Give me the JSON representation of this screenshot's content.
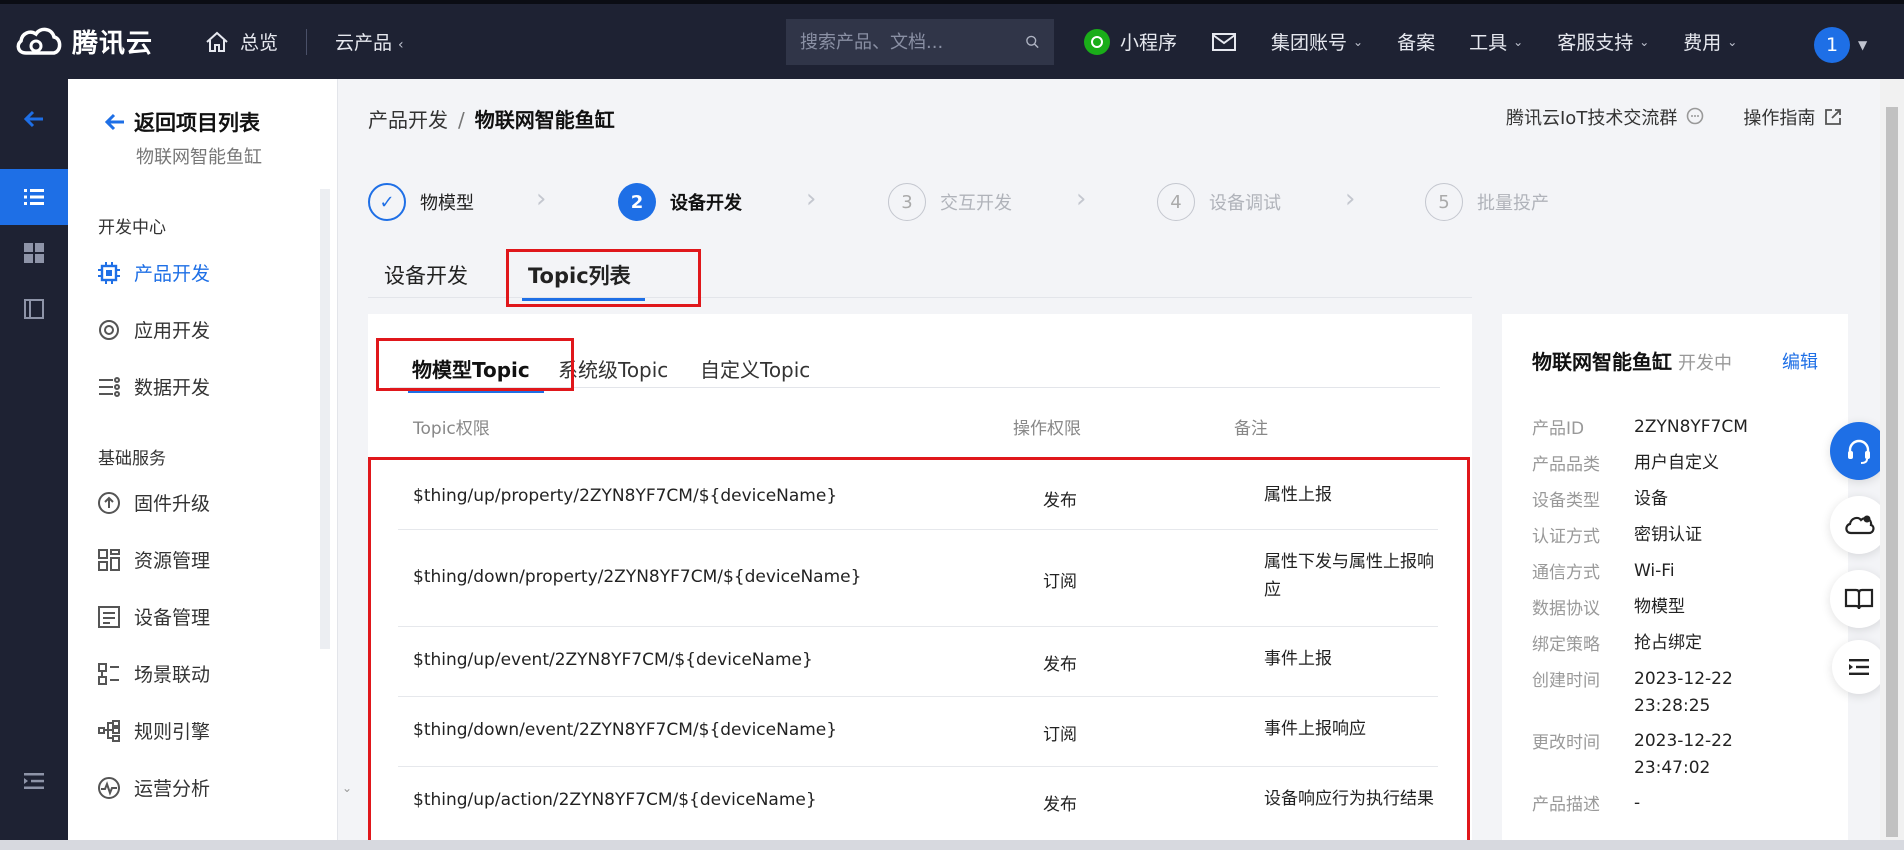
{
  "topnav": {
    "logo_text": "腾讯云",
    "home_label": "总览",
    "products_label": "云产品",
    "search_placeholder": "搜索产品、文档...",
    "items": {
      "mini": "小程序",
      "group_account": "集团账号",
      "record": "备案",
      "tools": "工具",
      "support": "客服支持",
      "fees": "费用"
    },
    "avatar": "1"
  },
  "sidebar": {
    "back_label": "返回项目列表",
    "project_name": "物联网智能鱼缸",
    "group1": "开发中心",
    "group2": "基础服务",
    "items": [
      {
        "label": "产品开发"
      },
      {
        "label": "应用开发"
      },
      {
        "label": "数据开发"
      },
      {
        "label": "固件升级"
      },
      {
        "label": "资源管理"
      },
      {
        "label": "设备管理"
      },
      {
        "label": "场景联动"
      },
      {
        "label": "规则引擎"
      },
      {
        "label": "运营分析"
      }
    ]
  },
  "breadcrumb": {
    "parent": "产品开发",
    "sep": "/",
    "current": "物联网智能鱼缸"
  },
  "links": {
    "community": "腾讯云IoT技术交流群",
    "guide": "操作指南"
  },
  "steps": [
    {
      "num": "✓",
      "label": "物模型"
    },
    {
      "num": "2",
      "label": "设备开发"
    },
    {
      "num": "3",
      "label": "交互开发"
    },
    {
      "num": "4",
      "label": "设备调试"
    },
    {
      "num": "5",
      "label": "批量投产"
    }
  ],
  "tabs": {
    "device_dev": "设备开发",
    "topic_list": "Topic列表"
  },
  "subtabs": {
    "model": "物模型Topic",
    "system": "系统级Topic",
    "custom": "自定义Topic"
  },
  "table": {
    "headers": {
      "topic": "Topic权限",
      "perm": "操作权限",
      "note": "备注"
    },
    "rows": [
      {
        "topic": "$thing/up/property/2ZYN8YF7CM/${deviceName}",
        "perm": "发布",
        "note": "属性上报"
      },
      {
        "topic": "$thing/down/property/2ZYN8YF7CM/${deviceName}",
        "perm": "订阅",
        "note": "属性下发与属性上报响应"
      },
      {
        "topic": "$thing/up/event/2ZYN8YF7CM/${deviceName}",
        "perm": "发布",
        "note": "事件上报"
      },
      {
        "topic": "$thing/down/event/2ZYN8YF7CM/${deviceName}",
        "perm": "订阅",
        "note": "事件上报响应"
      },
      {
        "topic": "$thing/up/action/2ZYN8YF7CM/${deviceName}",
        "perm": "发布",
        "note": "设备响应行为执行结果"
      }
    ]
  },
  "info": {
    "name": "物联网智能鱼缸",
    "status": "开发中",
    "edit": "编辑",
    "fields": [
      {
        "k": "产品ID",
        "v": "2ZYN8YF7CM"
      },
      {
        "k": "产品品类",
        "v": "用户自定义"
      },
      {
        "k": "设备类型",
        "v": "设备"
      },
      {
        "k": "认证方式",
        "v": "密钥认证"
      },
      {
        "k": "通信方式",
        "v": "Wi-Fi"
      },
      {
        "k": "数据协议",
        "v": "物模型"
      },
      {
        "k": "绑定策略",
        "v": "抢占绑定"
      },
      {
        "k": "创建时间",
        "v": "2023-12-22 23:28:25"
      },
      {
        "k": "更改时间",
        "v": "2023-12-22 23:47:02"
      },
      {
        "k": "产品描述",
        "v": "-"
      }
    ]
  },
  "colors": {
    "accent": "#1e6fe6",
    "nav_bg": "#1e2233",
    "highlight": "#e0171b"
  }
}
